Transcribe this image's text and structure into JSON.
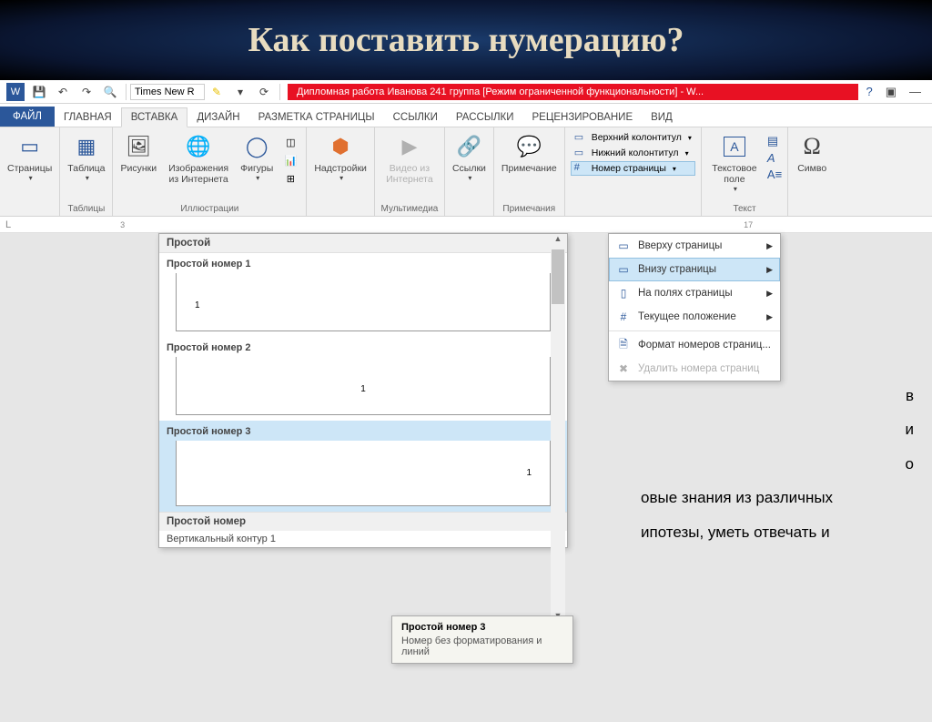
{
  "slide": {
    "title": "Как поставить нумерацию?"
  },
  "titlebar": "Дипломная работа Иванова 241 группа [Режим ограниченной функциональности]  -  W...",
  "qat_font": "Times New R",
  "tabs": {
    "file": "ФАЙЛ",
    "home": "ГЛАВНАЯ",
    "insert": "ВСТАВКА",
    "design": "ДИЗАЙН",
    "layout": "РАЗМЕТКА СТРАНИЦЫ",
    "refs": "ССЫЛКИ",
    "mail": "РАССЫЛКИ",
    "review": "РЕЦЕНЗИРОВАНИЕ",
    "view": "ВИД"
  },
  "ribbon": {
    "pages": "Страницы",
    "table": "Таблица",
    "tables_group": "Таблицы",
    "pictures": "Рисунки",
    "online_pics": "Изображения из Интернета",
    "shapes": "Фигуры",
    "illustrations_group": "Иллюстрации",
    "addins": "Надстройки",
    "online_video": "Видео из Интернета",
    "media_group": "Мультимедиа",
    "links": "Ссылки",
    "comment": "Примечание",
    "comments_group": "Примечания",
    "header": "Верхний колонтитул",
    "footer": "Нижний колонтитул",
    "page_number": "Номер страницы",
    "textbox": "Текстовое поле",
    "text_group": "Текст",
    "symbol": "Симво"
  },
  "dropdown": {
    "top": "Вверху страницы",
    "bottom": "Внизу страницы",
    "margins": "На полях страницы",
    "current": "Текущее положение",
    "format": "Формат номеров страниц...",
    "remove": "Удалить номера страниц"
  },
  "gallery": {
    "header": "Простой",
    "item1": "Простой номер 1",
    "item2": "Простой номер 2",
    "item3": "Простой номер 3",
    "footer": "Простой номер",
    "sub": "Вертикальный контур 1",
    "num": "1"
  },
  "tooltip": {
    "title": "Простой номер 3",
    "desc": "Номер без форматирования и линий"
  },
  "doc": {
    "l1": "в",
    "l2": "и",
    "l3": "о",
    "l4": "овые знания из различных",
    "l5": "ипотезы, уметь отвечать и"
  },
  "ruler": {
    "m3": "3",
    "m17": "17"
  }
}
